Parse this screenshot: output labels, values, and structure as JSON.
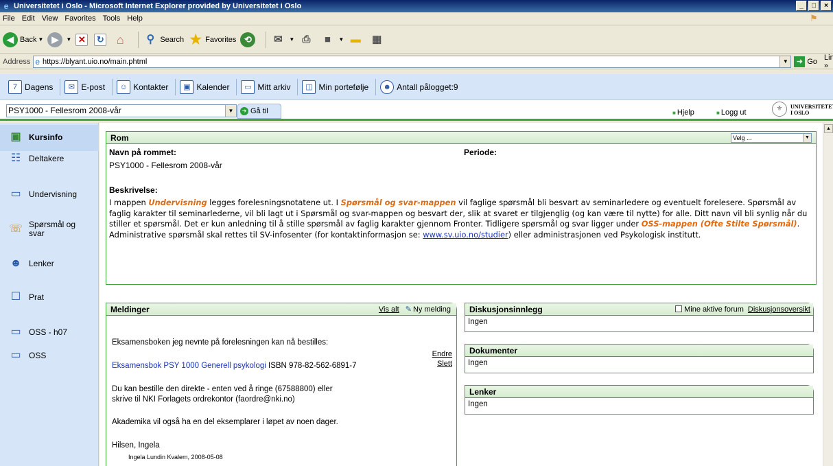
{
  "window": {
    "title": "Universitetet i Oslo - Microsoft Internet Explorer provided by Universitetet i Oslo",
    "controls": [
      "_",
      "□",
      "×"
    ]
  },
  "menu": [
    "File",
    "Edit",
    "View",
    "Favorites",
    "Tools",
    "Help"
  ],
  "toolbar": {
    "back": "Back",
    "search": "Search",
    "favorites": "Favorites"
  },
  "address": {
    "label": "Address",
    "url": "https://blyant.uio.no/main.phtml",
    "go": "Go",
    "links": "Links »"
  },
  "appnav": {
    "items": [
      {
        "label": "Dagens",
        "icon": "calendar-day-icon"
      },
      {
        "label": "E-post",
        "icon": "email-icon"
      },
      {
        "label": "Kontakter",
        "icon": "contacts-icon"
      },
      {
        "label": "Kalender",
        "icon": "calendar-icon"
      },
      {
        "label": "Mitt arkiv",
        "icon": "folder-icon"
      },
      {
        "label": "Min portefølje",
        "icon": "portfolio-icon"
      }
    ],
    "online": "Antall pålogget:9"
  },
  "course": {
    "selected": "PSY1000 - Fellesrom 2008-vår",
    "goto": "Gå til",
    "help": "Hjelp",
    "logout": "Logg ut",
    "brand_line1": "UNIVERSITETET",
    "brand_line2": "I OSLO"
  },
  "sidebar": {
    "items": [
      {
        "label": "Kursinfo",
        "icon": "course-info-icon"
      },
      {
        "label": "Deltakere",
        "icon": "participants-icon"
      },
      {
        "label": "Undervisning",
        "icon": "folder-icon"
      },
      {
        "label1": "Spørsmål og",
        "label2": "svar",
        "icon": "qa-icon"
      },
      {
        "label": "Lenker",
        "icon": "links-icon"
      },
      {
        "label": "Prat",
        "icon": "chat-icon"
      },
      {
        "label": "OSS - h07",
        "icon": "folder-icon"
      },
      {
        "label": "OSS",
        "icon": "folder-icon"
      }
    ]
  },
  "rom": {
    "title": "Rom",
    "velg": "Velg ...",
    "name_label": "Navn på rommet:",
    "name_value": "PSY1000 - Fellesrom 2008-vår",
    "period_label": "Periode:",
    "desc_label": "Beskrivelse:",
    "desc": {
      "p1": "I mappen ",
      "undervisning": "Undervisning",
      "p2": " legges forelesningsnotatene ut. I ",
      "sporsmal": "Spørsmål og svar-mappen",
      "p3": " vil faglige spørsmål bli besvart av seminarledere og eventuelt forelesere. Spørsmål av faglig karakter til seminarlederne, vil bli lagt ut i Spørsmål og svar-mappen og besvart der, slik at svaret er tilgjenglig (og kan være til nytte) for alle. Ditt navn vil bli synlig når du stiller et spørsmål. Det er kun anledning til å stille spørsmål av faglig karakter gjennom Fronter. Tidligere spørsmål og svar ligger under ",
      "oss": "OSS-mappen (Ofte Stilte Spørsmål)",
      "p4": ". Administrative spørsmål skal rettes til SV-infosenter (for kontaktinformasjon se: ",
      "link": "www.sv.uio.no/studier",
      "p5": ") eller administrasjonen ved Psykologisk institutt."
    }
  },
  "meldinger": {
    "title": "Meldinger",
    "vis_alt": "Vis alt",
    "ny": "Ny melding",
    "line1": "Eksamensboken jeg nevnte på forelesningen kan nå bestilles:",
    "book_link": "Eksamensbok PSY 1000 Generell psykologi",
    "isbn": " ISBN 978-82-562-6891-7",
    "line3a": "Du kan bestille den direkte - enten ved å ringe (67588800) eller",
    "line3b": "skrive til NKI Forlagets ordrekontor (faordre@nki.no)",
    "line4": "Akademika vil også ha en del eksemplarer i løpet av noen dager.",
    "line5": "Hilsen, Ingela",
    "sig": "Ingela Lundin Kvalem,  2008-05-08",
    "endre": "Endre",
    "slett": "Slett"
  },
  "diskusjon": {
    "title": "Diskusjonsinnlegg",
    "mine": "Mine aktive forum",
    "oversikt": "Diskusjonsoversikt",
    "value": "Ingen"
  },
  "dokumenter": {
    "title": "Dokumenter",
    "value": "Ingen"
  },
  "lenker": {
    "title": "Lenker",
    "value": "Ingen"
  }
}
